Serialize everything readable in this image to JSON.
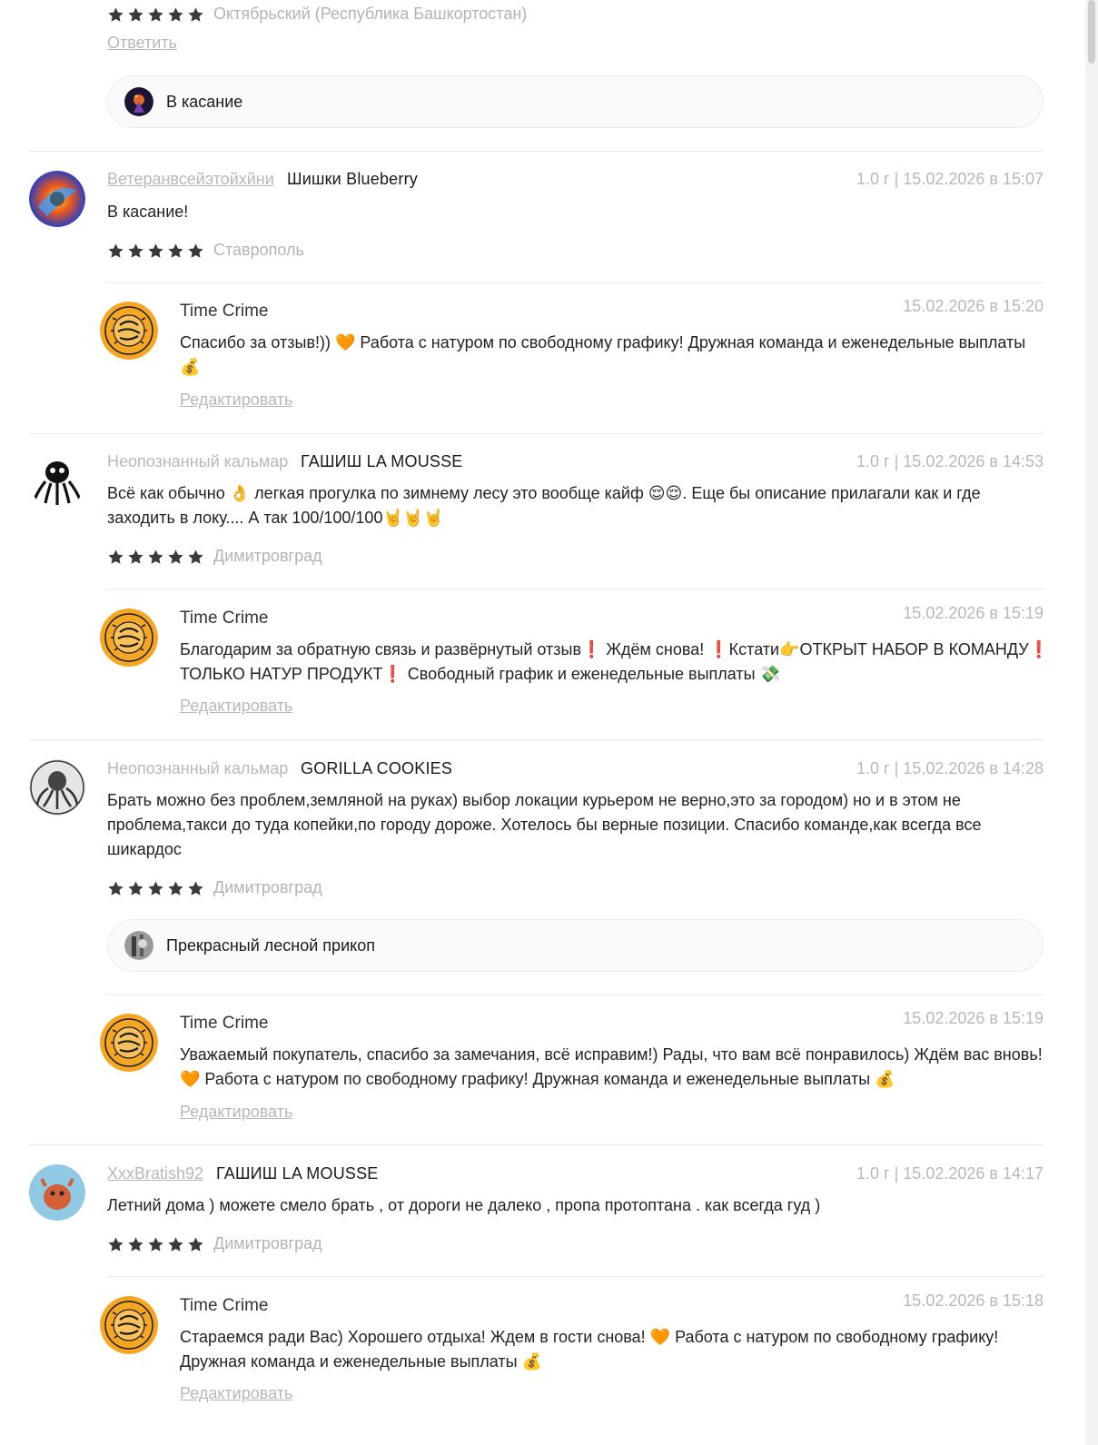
{
  "top": {
    "city": "Октябрьский (Республика Башкортостан)",
    "reply_link": "Ответить",
    "reaction": "В касание"
  },
  "reviews": [
    {
      "user": "Ветеранвсейэтойхйни",
      "product": "Шишки Blueberry",
      "meta": "1.0 г | 15.02.2026 в 15:07",
      "text": "В касание!",
      "city": "Ставрополь",
      "reply": {
        "author": "Time Crime",
        "date": "15.02.2026 в 15:20",
        "line1": "Спасибо за отзыв!)) 🧡 Работа с натуром по свободному графику! Дружная команда и еженедельные выплаты",
        "line2": "💰",
        "edit": "Редактировать"
      }
    },
    {
      "user": "Неопознанный кальмар",
      "product": "ГАШИШ LA MOUSSE",
      "meta": "1.0 г | 15.02.2026 в 14:53",
      "line1": "Всё как обычно 👌 легкая прогулка по зимнему лесу это вообще кайф 😌😌. Еще бы описание прилагали как и где",
      "line2": "заходить в локу.... А так 100/100/100🤘🤘🤘",
      "city": "Димитровград",
      "reply": {
        "author": "Time Crime",
        "date": "15.02.2026 в 15:19",
        "line1": "Благодарим за обратную связь и развёрнутый отзыв❗ Ждём снова! ❗Кстати👉ОТКРЫТ НАБОР В КОМАНДУ❗",
        "line2": "ТОЛЬКО НАТУР ПРОДУКТ❗ Свободный график и еженедельные выплаты 💸",
        "edit": "Редактировать"
      }
    },
    {
      "user": "Неопознанный кальмар",
      "product": "GORILLA COOKIES",
      "meta": "1.0 г | 15.02.2026 в 14:28",
      "line1": "Брать можно без проблем,земляной на руках) выбор локации курьером не верно,это за городом) но и в этом не",
      "line2": "проблема,такси до туда копейки,по городу дороже. Хотелось бы верные позиции. Спасибо команде,как всегда все",
      "line3": "шикардос",
      "city": "Димитровград",
      "reaction": "Прекрасный лесной прикоп",
      "reply": {
        "author": "Time Crime",
        "date": "15.02.2026 в 15:19",
        "line1": "Уважаемый покупатель, спасибо за замечания, всё исправим!) Рады, что вам всё понравилось) Ждём вас вновь!",
        "line2": "🧡 Работа с натуром по свободному графику! Дружная команда и еженедельные выплаты 💰",
        "edit": "Редактировать"
      }
    },
    {
      "user": "XxxBratish92",
      "product": "ГАШИШ LA MOUSSE",
      "meta": "1.0 г | 15.02.2026 в 14:17",
      "text": "Летний дома ) можете смело брать , от дороги не далеко , пропа протоптана . как всегда гуд )",
      "city": "Димитровград",
      "reply": {
        "author": "Time Crime",
        "date": "15.02.2026 в 15:18",
        "line1": "Стараемся ради Вас) Хорошего отдыха! Ждем в гости снова! 🧡 Работа с натуром по свободному графику!",
        "line2": "Дружная команда и еженедельные выплаты 💰",
        "edit": "Редактировать"
      }
    }
  ],
  "colors": {
    "star": "#3a3a3a",
    "muted_text": "#b8b8b8",
    "divider": "#e9e9e9",
    "brand_orange": "#f5a623"
  },
  "icons": [
    "star-icon",
    "user-avatar",
    "shop-logo-avatar",
    "reaction-avatar"
  ]
}
